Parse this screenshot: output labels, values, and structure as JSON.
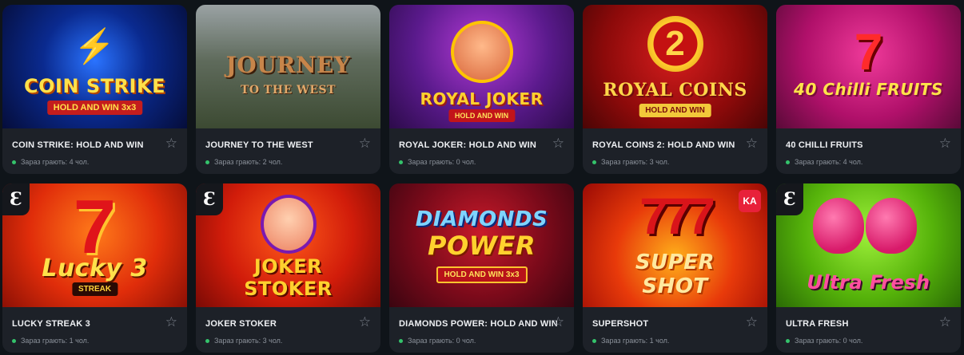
{
  "online_label_prefix": "Зараз грають:",
  "games": [
    {
      "name": "COIN STRIKE: HOLD AND WIN",
      "online": "Зараз грають: 4 чол.",
      "art_title": "COIN STRIKE",
      "art_sub": "HOLD AND WIN 3x3",
      "art_badge": "⚡"
    },
    {
      "name": "JOURNEY TO THE WEST",
      "online": "Зараз грають: 2 чол.",
      "art_title": "JOURNEY",
      "art_sub": "TO THE WEST"
    },
    {
      "name": "ROYAL JOKER: HOLD AND WIN",
      "online": "Зараз грають: 0 чол.",
      "art_title": "ROYAL JOKER",
      "art_sub": "HOLD AND WIN"
    },
    {
      "name": "ROYAL COINS 2: HOLD AND WIN",
      "online": "Зараз грають: 3 чол.",
      "art_title": "ROYAL COINS",
      "art_sub": "HOLD AND WIN",
      "art_badge": "2"
    },
    {
      "name": "40 CHILLI FRUITS",
      "online": "Зараз грають: 4 чол.",
      "art_title": "40 Chilli FRUITS",
      "art_badge": "7"
    },
    {
      "name": "LUCKY STREAK 3",
      "online": "Зараз грають: 1 чол.",
      "art_title": "Lucky 3",
      "art_sub": "STREAK",
      "art_badge": "7",
      "provider": "Ɛ"
    },
    {
      "name": "JOKER STOKER",
      "online": "Зараз грають: 3 чол.",
      "art_title": "JOKER",
      "art_sub": "STOKER",
      "provider": "Ɛ"
    },
    {
      "name": "DIAMONDS POWER: HOLD AND WIN",
      "online": "Зараз грають: 0 чол.",
      "art_title": "DIAMONDS",
      "art_sub": "HOLD AND WIN 3x3",
      "art_title2": "POWER"
    },
    {
      "name": "SUPERSHOT",
      "online": "Зараз грають: 1 чол.",
      "art_title": "SUPER",
      "art_title2": "SHOT",
      "art_badge": "777",
      "provider_badge": "KA"
    },
    {
      "name": "ULTRA FRESH",
      "online": "Зараз грають: 0 чол.",
      "art_title": "Ultra Fresh",
      "provider": "Ɛ"
    }
  ],
  "star_icon": "☆",
  "colors": {
    "card_bg": "#1d2128",
    "online_dot": "#34c36b",
    "page_bg": "#0f1419"
  }
}
